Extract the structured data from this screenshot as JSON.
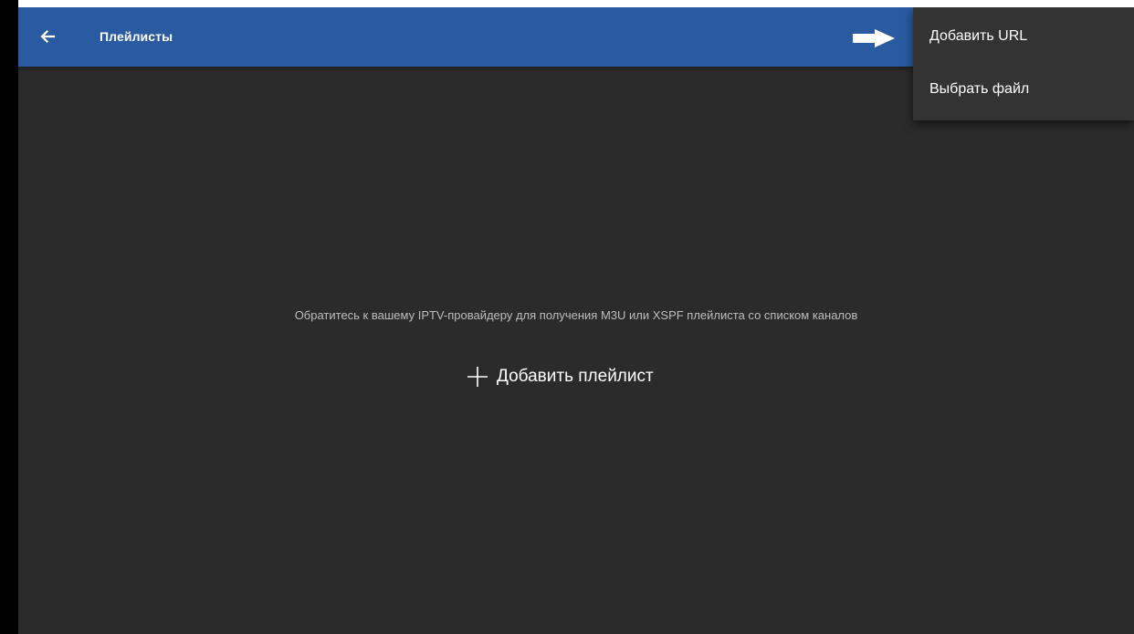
{
  "appbar": {
    "title": "Плейлисты",
    "back_icon": "arrow-left-icon",
    "color": "#2a5aa0"
  },
  "menu": {
    "items": [
      {
        "label": "Добавить URL"
      },
      {
        "label": "Выбрать файл"
      }
    ]
  },
  "main": {
    "hint": "Обратитесь к вашему IPTV-провайдеру для получения M3U или XSPF плейлиста со списком каналов",
    "add_label": "Добавить плейлист",
    "add_icon": "plus-icon"
  },
  "annotation": {
    "icon": "right-arrow-pointer-icon",
    "color": "#ffffff"
  },
  "colors": {
    "background": "#2b2b2b",
    "menu_background": "#333333",
    "hint_text": "#bdbdbd"
  }
}
